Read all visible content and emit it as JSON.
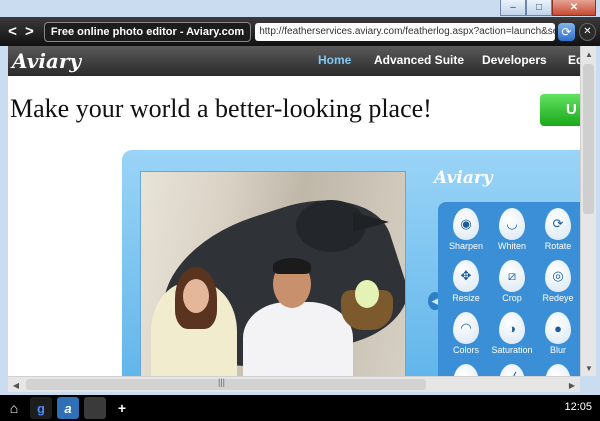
{
  "window": {
    "controls": {
      "minimize": "–",
      "maximize": "□",
      "close": "✕"
    }
  },
  "toolbar": {
    "back": "<",
    "forward": ">",
    "tab_title": "Free online photo editor - Aviary.com",
    "url": "http://featherservices.aviary.com/featherlog.aspx?action=launch&sessi",
    "reload_icon": "refresh-icon",
    "close_icon": "close-icon"
  },
  "site": {
    "logo": "Aviary",
    "nav": [
      {
        "label": "Home",
        "active": true
      },
      {
        "label": "Advanced Suite",
        "active": false
      },
      {
        "label": "Developers",
        "active": false
      },
      {
        "label": "Ed",
        "active": false
      }
    ],
    "headline": "Make your world a better-looking place!",
    "cta_label": "U"
  },
  "editor": {
    "panel_logo": "Aviary",
    "tools": [
      {
        "label": "Sharpen",
        "icon": "sharpen-icon",
        "glyph": "◉"
      },
      {
        "label": "Whiten",
        "icon": "whiten-icon",
        "glyph": "◡"
      },
      {
        "label": "Rotate",
        "icon": "rotate-icon",
        "glyph": "⟳"
      },
      {
        "label": "Resize",
        "icon": "resize-icon",
        "glyph": "✥"
      },
      {
        "label": "Crop",
        "icon": "crop-icon",
        "glyph": "⧄"
      },
      {
        "label": "Redeye",
        "icon": "redeye-icon",
        "glyph": "◎"
      },
      {
        "label": "Colors",
        "icon": "colors-icon",
        "glyph": "◠"
      },
      {
        "label": "Saturation",
        "icon": "saturation-icon",
        "glyph": "◑"
      },
      {
        "label": "Blur",
        "icon": "blur-icon",
        "glyph": "●"
      },
      {
        "label": "",
        "icon": "tool-10-icon",
        "glyph": "◐"
      },
      {
        "label": "",
        "icon": "tool-11-icon",
        "glyph": "╱"
      },
      {
        "label": "",
        "icon": "text-icon",
        "glyph": "T"
      }
    ],
    "collapse_icon": "chevron-left-icon"
  },
  "taskbar": {
    "clock": "12:05",
    "items": [
      "home-icon",
      "google-icon",
      "aviary-icon",
      "blank-tab",
      "add-icon"
    ]
  },
  "colors": {
    "accent": "#7ec8f4",
    "cta": "#19a919",
    "editor_bg": "#5fb4ea"
  }
}
